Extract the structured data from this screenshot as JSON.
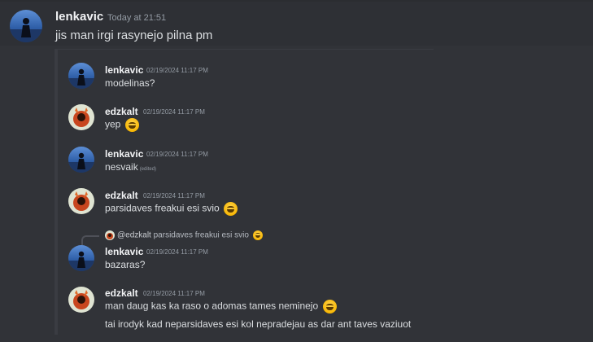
{
  "main": {
    "username": "lenkavic",
    "time": "Today at 21:51",
    "text": "jis man irgi rasynejo pilna pm"
  },
  "embed": {
    "messages": [
      {
        "username": "lenkavic",
        "time": "02/19/2024 11:17 PM",
        "text": "modelinas?"
      },
      {
        "username": "edzkalt",
        "time": "02/19/2024 11:17 PM",
        "text": "yep"
      },
      {
        "username": "lenkavic",
        "time": "02/19/2024 11:17 PM",
        "text": "nesvaik",
        "edited": "(edited)"
      },
      {
        "username": "edzkalt",
        "time": "02/19/2024 11:17 PM",
        "text": "parsidaves freakui esi svio"
      },
      {
        "username": "lenkavic",
        "time": "02/19/2024 11:17 PM",
        "text": "bazaras?"
      },
      {
        "username": "edzkalt",
        "time": "02/19/2024 11:17 PM",
        "text": "man daug kas ka raso o adomas tames neminejo",
        "text2": "tai irodyk kad neparsidaves esi kol nepradejau as dar ant taves vaziuot"
      }
    ],
    "reply": {
      "user": "@edzkalt",
      "text": "parsidaves freakui esi svio"
    }
  },
  "emoji": "grinning-squinting-face",
  "colors": {
    "background": "#313338",
    "message_highlight": "#2e3035",
    "username": "#f2f3f5",
    "timestamp": "#949ba4",
    "text": "#dbdee1",
    "embed_border": "#3a3c42"
  }
}
